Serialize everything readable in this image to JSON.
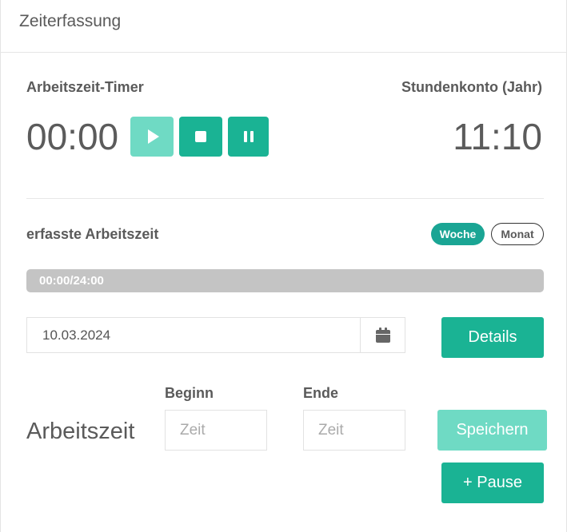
{
  "header": {
    "title": "Zeiterfassung"
  },
  "timer": {
    "label": "Arbeitszeit-Timer",
    "value": "00:00",
    "controls": {
      "play": "play-icon",
      "stop": "stop-icon",
      "pause": "pause-icon"
    }
  },
  "konto": {
    "label": "Stundenkonto (Jahr)",
    "value": "11:10"
  },
  "erfasst": {
    "label": "erfasste Arbeitszeit",
    "toggle": {
      "woche": "Woche",
      "monat": "Monat",
      "active": "Woche"
    },
    "progress": {
      "text": "00:00/24:00",
      "fraction": 0
    }
  },
  "date": {
    "value": "10.03.2024",
    "icon": "calendar-icon"
  },
  "buttons": {
    "details": "Details",
    "save": "Speichern",
    "add_pause": "+ Pause"
  },
  "entry": {
    "row_label": "Arbeitszeit",
    "beginn_label": "Beginn",
    "ende_label": "Ende",
    "beginn_placeholder": "Zeit",
    "ende_placeholder": "Zeit"
  },
  "colors": {
    "accent": "#1ab394",
    "accent_light": "#6fdac4",
    "pill_active": "#1aa594",
    "progress_track": "#c4c4c4"
  }
}
